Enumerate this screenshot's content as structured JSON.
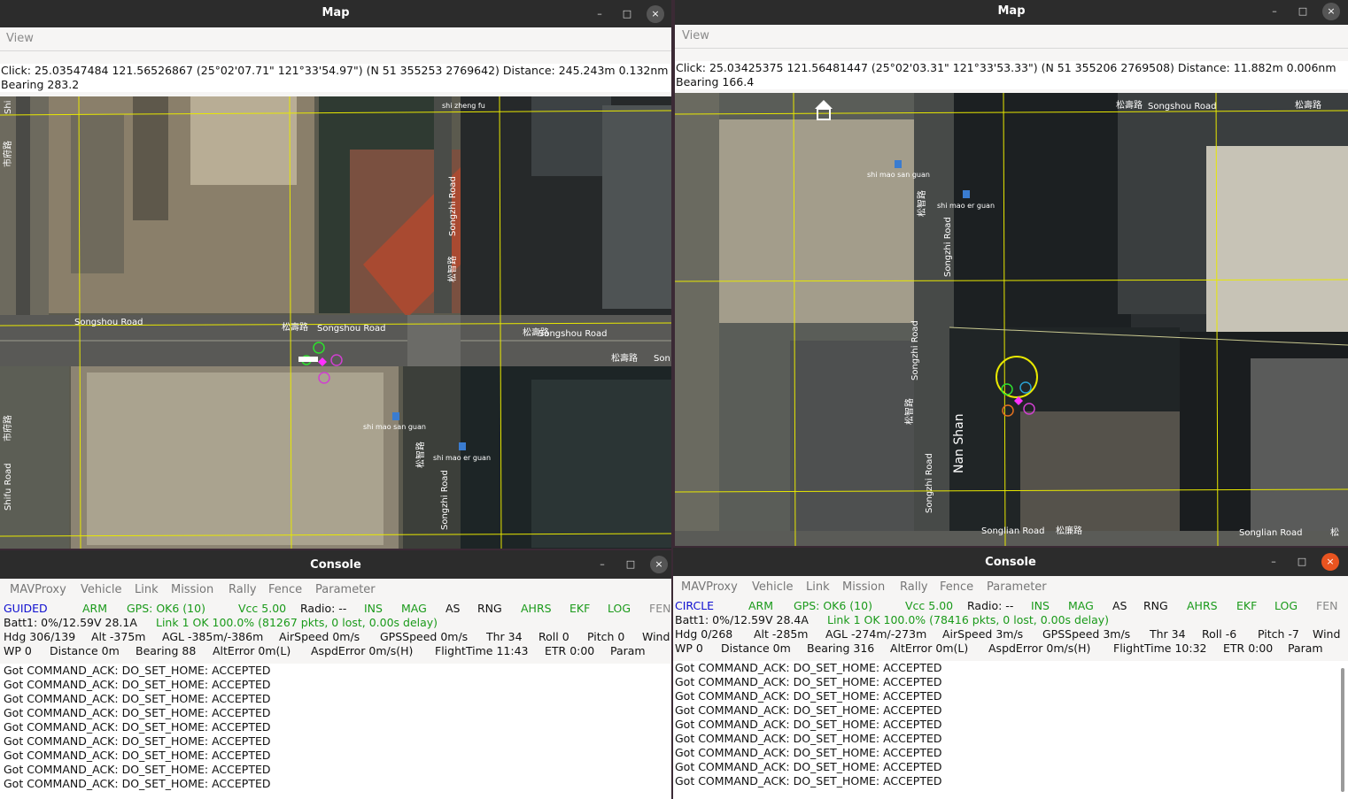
{
  "left_map": {
    "title": "Map",
    "menu": [
      "View"
    ],
    "click_text": "Click: 25.03547484 121.56526867 (25°02'07.71\" 121°33'54.97\") (N 51 355253 2769642)  Distance: 245.243m 0.132nm",
    "bearing_text": "Bearing 283.2",
    "labels": [
      "Songshou Road",
      "松壽路",
      "Songshou Road",
      "松壽路",
      "Songshou Road",
      "松壽路",
      "Son",
      "Songzhi Road",
      "松智路",
      "shi zheng fu",
      "shi mao san guan",
      "shi mao er guan",
      "Songzhi Road",
      "松智路",
      "Shifu Road",
      "市府路",
      "Shi",
      "市府路"
    ]
  },
  "right_map": {
    "title": "Map",
    "menu": [
      "View"
    ],
    "click_text": "Click: 25.03425375 121.56481447 (25°02'03.31\" 121°33'53.33\") (N 51 355206 2769508)  Distance: 11.882m 0.006nm",
    "bearing_text": "Bearing 166.4",
    "labels": [
      "松壽路",
      "Songshou Road",
      "松壽路",
      "shi mao san guan",
      "shi mao er guan",
      "Songzhi Road",
      "松智路",
      "Songzhi Road",
      "松智路",
      "Songzhi Road",
      "Nan Shan",
      "Songlian Road",
      "松廉路",
      "Songlian Road",
      "松"
    ]
  },
  "left_console": {
    "title": "Console",
    "menu": [
      "MAVProxy",
      "Vehicle",
      "Link",
      "Mission",
      "Rally",
      "Fence",
      "Parameter"
    ],
    "row1": [
      "GUIDED",
      "ARM",
      "GPS: OK6 (10)",
      "Vcc 5.00",
      "Radio: --",
      "INS",
      "MAG",
      "AS",
      "RNG",
      "AHRS",
      "EKF",
      "LOG",
      "FEN"
    ],
    "row2_batt": "Batt1: 0%/12.59V 28.1A",
    "row2_link": "Link 1 OK 100.0% (81267 pkts, 0 lost, 0.00s delay)",
    "row3": [
      "Hdg 306/139",
      "Alt -375m",
      "AGL -385m/-386m",
      "AirSpeed 0m/s",
      "GPSSpeed 0m/s",
      "Thr 34",
      "Roll 0",
      "Pitch 0",
      "Wind"
    ],
    "row4": [
      "WP 0",
      "Distance 0m",
      "Bearing 88",
      "AltError 0m(L)",
      "AspdError 0m/s(H)",
      "FlightTime 11:43",
      "ETR 0:00",
      "Param"
    ],
    "log": [
      "Got COMMAND_ACK: DO_SET_HOME: ACCEPTED",
      "Got COMMAND_ACK: DO_SET_HOME: ACCEPTED",
      "Got COMMAND_ACK: DO_SET_HOME: ACCEPTED",
      "Got COMMAND_ACK: DO_SET_HOME: ACCEPTED",
      "Got COMMAND_ACK: DO_SET_HOME: ACCEPTED",
      "Got COMMAND_ACK: DO_SET_HOME: ACCEPTED",
      "Got COMMAND_ACK: DO_SET_HOME: ACCEPTED",
      "Got COMMAND_ACK: DO_SET_HOME: ACCEPTED",
      "Got COMMAND_ACK: DO_SET_HOME: ACCEPTED"
    ]
  },
  "right_console": {
    "title": "Console",
    "menu": [
      "MAVProxy",
      "Vehicle",
      "Link",
      "Mission",
      "Rally",
      "Fence",
      "Parameter"
    ],
    "row1": [
      "CIRCLE",
      "ARM",
      "GPS: OK6 (10)",
      "Vcc 5.00",
      "Radio: --",
      "INS",
      "MAG",
      "AS",
      "RNG",
      "AHRS",
      "EKF",
      "LOG",
      "FEN"
    ],
    "row2_batt": "Batt1: 0%/12.59V 28.4A",
    "row2_link": "Link 1 OK 100.0% (78416 pkts, 0 lost, 0.00s delay)",
    "row3": [
      "Hdg  0/268",
      "Alt -285m",
      "AGL -274m/-273m",
      "AirSpeed 3m/s",
      "GPSSpeed 3m/s",
      "Thr 34",
      "Roll -6",
      "Pitch -7",
      "Wind"
    ],
    "row4": [
      "WP 0",
      "Distance 0m",
      "Bearing 316",
      "AltError 0m(L)",
      "AspdError 0m/s(H)",
      "FlightTime 10:32",
      "ETR 0:00",
      "Param"
    ],
    "log": [
      "Got COMMAND_ACK: DO_SET_HOME: ACCEPTED",
      "Got COMMAND_ACK: DO_SET_HOME: ACCEPTED",
      "Got COMMAND_ACK: DO_SET_HOME: ACCEPTED",
      "Got COMMAND_ACK: DO_SET_HOME: ACCEPTED",
      "Got COMMAND_ACK: DO_SET_HOME: ACCEPTED",
      "Got COMMAND_ACK: DO_SET_HOME: ACCEPTED",
      "Got COMMAND_ACK: DO_SET_HOME: ACCEPTED",
      "Got COMMAND_ACK: DO_SET_HOME: ACCEPTED",
      "Got COMMAND_ACK: DO_SET_HOME: ACCEPTED"
    ]
  },
  "window_controls": {
    "minimize": "–",
    "maximize": "□",
    "close": "×"
  },
  "colors": {
    "status_green": "#1a9a1a",
    "mode_blue": "#1010d0",
    "grid_yellow": "#e8e800",
    "titlebar": "#2c2c2c",
    "close_red": "#e95420"
  }
}
